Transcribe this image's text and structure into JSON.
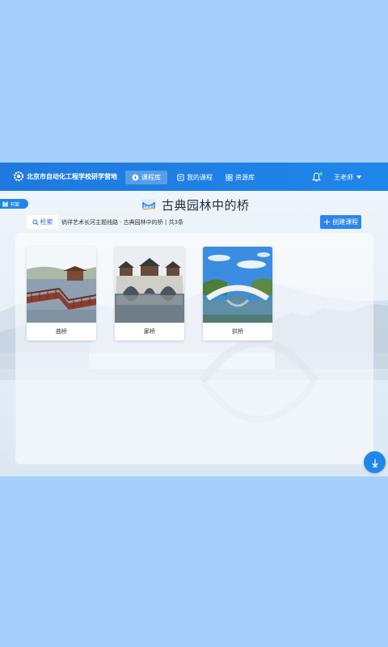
{
  "header": {
    "school_name": "北京市自动化工程学校研学营地",
    "nav": [
      {
        "label": "课程库",
        "icon": "compass-icon",
        "active": true
      },
      {
        "label": "我的课程",
        "icon": "book-icon",
        "active": false
      },
      {
        "label": "资源库",
        "icon": "grid-icon",
        "active": false
      }
    ],
    "user_name": "王老师",
    "colors": {
      "primary": "#1f86ea",
      "page_bg": "#a6d0fb"
    }
  },
  "shelf": {
    "label": "书架",
    "icon": "bookshelf-icon"
  },
  "page": {
    "title": "古典园林中的桥",
    "title_icon": "bridge-icon"
  },
  "toolbar": {
    "search_label": "检索",
    "breadcrumb": "徜徉艺术长河主题线路 · 古典园林中的桥丨共3条",
    "create_label": "创建课程"
  },
  "courses": [
    {
      "caption": "曲桥",
      "image": "zigzag-bridge-photo"
    },
    {
      "caption": "廊桥",
      "image": "covered-bridge-photo"
    },
    {
      "caption": "拱桥",
      "image": "arch-bridge-photo"
    }
  ],
  "scroll_down_icon": "arrow-down-icon"
}
